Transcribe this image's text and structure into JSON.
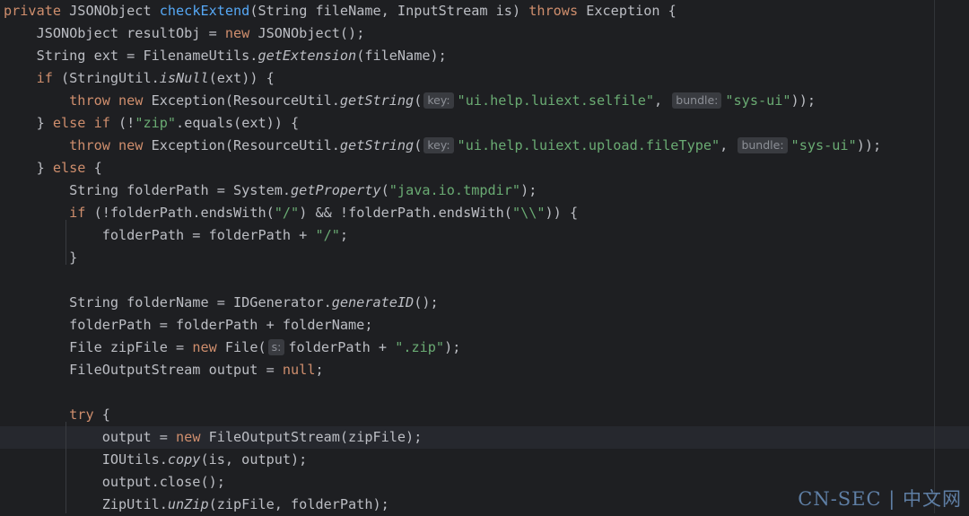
{
  "editor": {
    "lines": [
      [
        {
          "t": "private ",
          "c": "kw"
        },
        {
          "t": "JSONObject "
        },
        {
          "t": "checkExtend",
          "c": "fn"
        },
        {
          "t": "(String fileName, InputStream is) "
        },
        {
          "t": "throws ",
          "c": "kw"
        },
        {
          "t": "Exception {"
        }
      ],
      [
        {
          "t": "    JSONObject resultObj = "
        },
        {
          "t": "new ",
          "c": "kw"
        },
        {
          "t": "JSONObject();"
        }
      ],
      [
        {
          "t": "    String ext = FilenameUtils."
        },
        {
          "t": "getExtension",
          "c": "it"
        },
        {
          "t": "(fileName);"
        }
      ],
      [
        {
          "t": "    "
        },
        {
          "t": "if ",
          "c": "kw"
        },
        {
          "t": "(StringUtil."
        },
        {
          "t": "isNull",
          "c": "it"
        },
        {
          "t": "(ext)) {"
        }
      ],
      [
        {
          "t": "        "
        },
        {
          "t": "throw new ",
          "c": "kw"
        },
        {
          "t": "Exception(ResourceUtil."
        },
        {
          "t": "getString",
          "c": "it"
        },
        {
          "t": "("
        },
        {
          "hint": "key:"
        },
        {
          "t": "\"ui.help.luiext.selfile\"",
          "c": "str"
        },
        {
          "t": ", "
        },
        {
          "hint": "bundle:"
        },
        {
          "t": "\"sys-ui\"",
          "c": "str"
        },
        {
          "t": "));"
        }
      ],
      [
        {
          "t": "    } "
        },
        {
          "t": "else if ",
          "c": "kw"
        },
        {
          "t": "(!"
        },
        {
          "t": "\"zip\"",
          "c": "str"
        },
        {
          "t": ".equals(ext)) {"
        }
      ],
      [
        {
          "t": "        "
        },
        {
          "t": "throw new ",
          "c": "kw"
        },
        {
          "t": "Exception(ResourceUtil."
        },
        {
          "t": "getString",
          "c": "it"
        },
        {
          "t": "("
        },
        {
          "hint": "key:"
        },
        {
          "t": "\"ui.help.luiext.upload.fileType\"",
          "c": "str"
        },
        {
          "t": ", "
        },
        {
          "hint": "bundle:"
        },
        {
          "t": "\"sys-ui\"",
          "c": "str"
        },
        {
          "t": "));"
        }
      ],
      [
        {
          "t": "    } "
        },
        {
          "t": "else ",
          "c": "kw"
        },
        {
          "t": "{"
        }
      ],
      [
        {
          "t": "        String folderPath = System."
        },
        {
          "t": "getProperty",
          "c": "it"
        },
        {
          "t": "("
        },
        {
          "t": "\"java.io.tmpdir\"",
          "c": "str"
        },
        {
          "t": ");"
        }
      ],
      [
        {
          "t": "        "
        },
        {
          "t": "if ",
          "c": "kw"
        },
        {
          "t": "(!folderPath.endsWith("
        },
        {
          "t": "\"/\"",
          "c": "str"
        },
        {
          "t": ") && !folderPath.endsWith("
        },
        {
          "t": "\"\\\\\"",
          "c": "str"
        },
        {
          "t": ")) {"
        }
      ],
      [
        {
          "t": "            folderPath = folderPath + "
        },
        {
          "t": "\"/\"",
          "c": "str"
        },
        {
          "t": ";"
        }
      ],
      [
        {
          "t": "        }"
        }
      ],
      [],
      [
        {
          "t": "        String folderName = IDGenerator."
        },
        {
          "t": "generateID",
          "c": "it"
        },
        {
          "t": "();"
        }
      ],
      [
        {
          "t": "        folderPath = folderPath + folderName;"
        }
      ],
      [
        {
          "t": "        File zipFile = "
        },
        {
          "t": "new ",
          "c": "kw"
        },
        {
          "t": "File("
        },
        {
          "hint": "s:"
        },
        {
          "t": "folderPath + "
        },
        {
          "t": "\".zip\"",
          "c": "str"
        },
        {
          "t": ");"
        }
      ],
      [
        {
          "t": "        FileOutputStream output = "
        },
        {
          "t": "null",
          "c": "kw"
        },
        {
          "t": ";"
        }
      ],
      [],
      [
        {
          "t": "        "
        },
        {
          "t": "try ",
          "c": "kw"
        },
        {
          "t": "{"
        }
      ],
      [
        {
          "t": "            output = "
        },
        {
          "t": "new ",
          "c": "kw"
        },
        {
          "t": "FileOutputStream(zipFile);"
        }
      ],
      [
        {
          "t": "            IOUtils."
        },
        {
          "t": "copy",
          "c": "it"
        },
        {
          "t": "(is, output);"
        }
      ],
      [
        {
          "t": "            output.close();"
        }
      ],
      [
        {
          "t": "            ZipUtil."
        },
        {
          "t": "unZip",
          "c": "it"
        },
        {
          "t": "(zipFile, folderPath);"
        }
      ]
    ],
    "current_line": 19
  },
  "watermark": "CN-SEC | 中文网",
  "colors": {
    "background": "#1e1f22",
    "text": "#bcbec4",
    "keyword": "#cf8e6d",
    "method_declaration": "#56a8f5",
    "string": "#6aab73",
    "inlay_hint_bg": "#393b40",
    "inlay_hint_text": "#8c8f96",
    "current_line": "#26282e"
  }
}
